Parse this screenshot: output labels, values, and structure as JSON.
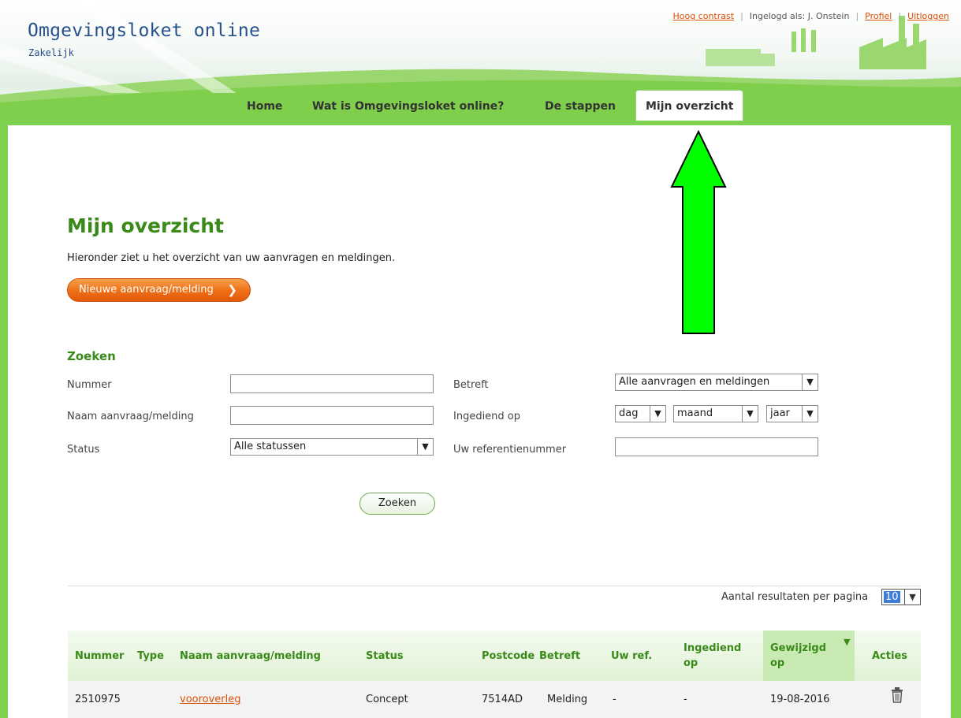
{
  "header": {
    "site_title": "Omgevingsloket online",
    "site_subtitle": "Zakelijk",
    "links": {
      "contrast": "Hoog contrast",
      "logged_in": "Ingelogd als: J. Onstein",
      "profile": "Profiel",
      "logout": "Uitloggen"
    }
  },
  "nav": {
    "tabs": [
      "Home",
      "Wat is Omgevingsloket online?",
      "De stappen",
      "Mijn overzicht"
    ],
    "active": "Mijn overzicht"
  },
  "main": {
    "title": "Mijn overzicht",
    "intro": "Hieronder ziet u het overzicht van uw aanvragen en meldingen.",
    "new_button": "Nieuwe aanvraag/melding",
    "new_button_chevron": "❯"
  },
  "search": {
    "title": "Zoeken",
    "labels": {
      "nummer": "Nummer",
      "naam": "Naam aanvraag/melding",
      "status": "Status",
      "betreft": "Betreft",
      "ingediend": "Ingediend op",
      "referentie": "Uw referentienummer"
    },
    "values": {
      "nummer": "",
      "naam": "",
      "status": "Alle statussen",
      "betreft": "Alle aanvragen en meldingen",
      "dag": "dag",
      "maand": "maand",
      "jaar": "jaar",
      "referentie": ""
    },
    "button": "Zoeken"
  },
  "results": {
    "per_page_label": "Aantal resultaten per pagina",
    "per_page_value": "10",
    "columns": {
      "nummer": "Nummer",
      "type": "Type",
      "naam": "Naam aanvraag/melding",
      "status": "Status",
      "postcode": "Postcode",
      "betreft": "Betreft",
      "uwref": "Uw ref.",
      "ingediend_1": "Ingediend",
      "ingediend_2": "op",
      "gewijzigd_1": "Gewijzigd",
      "gewijzigd_2": "op",
      "acties": "Acties"
    },
    "sort_indicator": "▼",
    "rows": [
      {
        "nummer": "2510975",
        "type": "",
        "naam": "vooroverleg",
        "status": "Concept",
        "postcode": "7514AD",
        "betreft": "Melding",
        "uwref": "-",
        "ingediend": "-",
        "gewijzigd": "19-08-2016"
      }
    ]
  },
  "icons": {
    "dropdown": "chevron-down-icon",
    "delete": "trash-icon",
    "annotation": "arrow-up-icon"
  },
  "colors": {
    "brand_green": "#3a8a1a",
    "bar_green": "#7fd24f",
    "link_orange": "#d9500a",
    "title_blue": "#27508c",
    "annotation_green": "#00ff00"
  }
}
